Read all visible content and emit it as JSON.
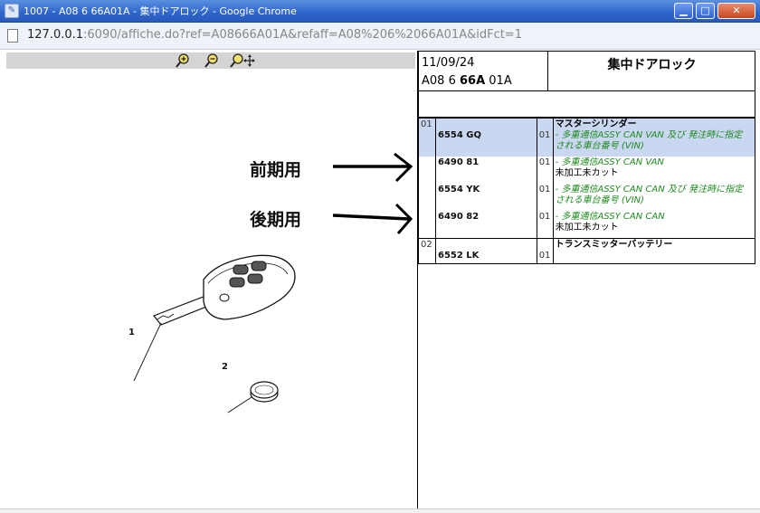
{
  "window": {
    "title": "1007 - A08 6 66A01A - 集中ドアロック - Google Chrome",
    "minimize": "▁",
    "maximize": "□",
    "close": "✕"
  },
  "address": {
    "host": "127.0.0.1",
    "rest": ":6090/affiche.do?ref=A08666A01A&refaff=A08%206%2066A01A&idFct=1"
  },
  "toolbar": {
    "zoom_in_icon": "zoom-in-icon",
    "zoom_out_icon": "zoom-out-icon",
    "pan_icon": "zoom-move-icon"
  },
  "diagram": {
    "callout_1": "1",
    "callout_2": "2"
  },
  "annotations": {
    "early": "前期用",
    "late": "後期用"
  },
  "header": {
    "date": "11/09/24",
    "ref_prefix": "A08 6 ",
    "ref_bold": "66A",
    "ref_suffix": " 01A",
    "title": "集中ドアロック"
  },
  "parts": {
    "groups": [
      {
        "group": "01",
        "name": "マスターシリンダー",
        "rows": [
          {
            "ref": "6554 GQ",
            "qty": "01",
            "lines": [
              {
                "text": "- 多重通信ASSY CAN VAN 及び 発注時に指定",
                "style": "green"
              },
              {
                "text": "される車台番号 (VIN)",
                "style": "green"
              }
            ]
          },
          {
            "ref": "6490 81",
            "qty": "01",
            "lines": [
              {
                "text": "- 多重通信ASSY CAN VAN",
                "style": "green"
              },
              {
                "text": "未加工未カット",
                "style": "black"
              }
            ]
          },
          {
            "ref": "6554 YK",
            "qty": "01",
            "lines": [
              {
                "text": "- 多重通信ASSY CAN CAN 及び 発注時に指定",
                "style": "green"
              },
              {
                "text": "される車台番号 (VIN)",
                "style": "green"
              }
            ]
          },
          {
            "ref": "6490 82",
            "qty": "01",
            "lines": [
              {
                "text": "- 多重通信ASSY CAN CAN",
                "style": "green"
              },
              {
                "text": "未加工未カット",
                "style": "black"
              }
            ]
          }
        ]
      },
      {
        "group": "02",
        "name": "トランスミッターバッテリー",
        "rows": [
          {
            "ref": "6552 LK",
            "qty": "01",
            "lines": []
          }
        ]
      }
    ]
  }
}
